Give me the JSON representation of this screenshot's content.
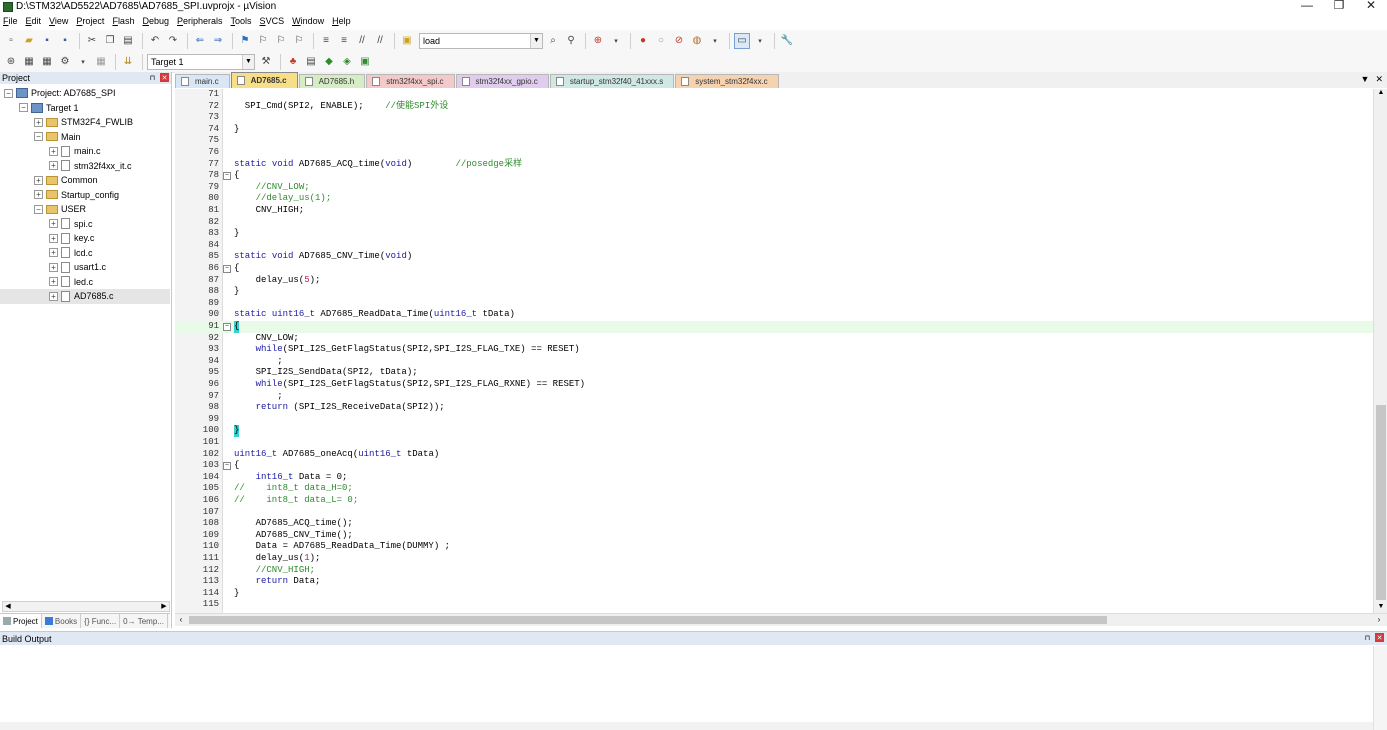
{
  "window": {
    "title": "D:\\STM32\\AD5522\\AD7685\\AD7685_SPI.uvprojx - µVision",
    "controls": [
      "—",
      "❐",
      "✕"
    ]
  },
  "menu": [
    "File",
    "Edit",
    "View",
    "Project",
    "Flash",
    "Debug",
    "Peripherals",
    "Tools",
    "SVCS",
    "Window",
    "Help"
  ],
  "toolbar": {
    "find_combo_value": "load",
    "target_combo_value": "Target 1"
  },
  "project_panel": {
    "title": "Project",
    "tree": [
      {
        "label": "Project: AD7685_SPI",
        "indent": 0,
        "kind": "project",
        "exp": "−"
      },
      {
        "label": "Target 1",
        "indent": 1,
        "kind": "target",
        "exp": "−"
      },
      {
        "label": "STM32F4_FWLIB",
        "indent": 2,
        "kind": "folder",
        "exp": "+"
      },
      {
        "label": "Main",
        "indent": 2,
        "kind": "folder",
        "exp": "−"
      },
      {
        "label": "main.c",
        "indent": 3,
        "kind": "file",
        "exp": "+"
      },
      {
        "label": "stm32f4xx_it.c",
        "indent": 3,
        "kind": "file",
        "exp": "+"
      },
      {
        "label": "Common",
        "indent": 2,
        "kind": "folder",
        "exp": "+"
      },
      {
        "label": "Startup_config",
        "indent": 2,
        "kind": "folder",
        "exp": "+"
      },
      {
        "label": "USER",
        "indent": 2,
        "kind": "folder",
        "exp": "−"
      },
      {
        "label": "spi.c",
        "indent": 3,
        "kind": "file",
        "exp": "+"
      },
      {
        "label": "key.c",
        "indent": 3,
        "kind": "file",
        "exp": "+"
      },
      {
        "label": "lcd.c",
        "indent": 3,
        "kind": "file",
        "exp": "+"
      },
      {
        "label": "usart1.c",
        "indent": 3,
        "kind": "file",
        "exp": "+"
      },
      {
        "label": "led.c",
        "indent": 3,
        "kind": "file",
        "exp": "+"
      },
      {
        "label": "AD7685.c",
        "indent": 3,
        "kind": "file",
        "exp": "+",
        "selected": true
      }
    ],
    "bottom_tabs": [
      "Project",
      "Books",
      "{} Func...",
      "0→ Temp..."
    ]
  },
  "editor_tabs": [
    {
      "label": "main.c",
      "color": "#d8e6f5",
      "active": false
    },
    {
      "label": "AD7685.c",
      "color": "#f7df8a",
      "active": true
    },
    {
      "label": "AD7685.h",
      "color": "#d5ecc4",
      "active": false
    },
    {
      "label": "stm32f4xx_spi.c",
      "color": "#f3c9c9",
      "active": false
    },
    {
      "label": "stm32f4xx_gpio.c",
      "color": "#e0cdee",
      "active": false
    },
    {
      "label": "startup_stm32f40_41xxx.s",
      "color": "#cfe8e3",
      "active": false
    },
    {
      "label": "system_stm32f4xx.c",
      "color": "#f6d3b0",
      "active": false
    }
  ],
  "code_lines": [
    {
      "n": "71",
      "t": ""
    },
    {
      "n": "72",
      "t": "  SPI_Cmd(SPI2, ENABLE);    //使能SPI外设"
    },
    {
      "n": "73",
      "t": ""
    },
    {
      "n": "74",
      "t": "}"
    },
    {
      "n": "75",
      "t": ""
    },
    {
      "n": "76",
      "t": ""
    },
    {
      "n": "77",
      "t": "static void AD7685_ACQ_time(void)        //posedge采样"
    },
    {
      "n": "78",
      "t": "{",
      "fold": "−"
    },
    {
      "n": "79",
      "t": "    //CNV_LOW;"
    },
    {
      "n": "80",
      "t": "    //delay_us(1);"
    },
    {
      "n": "81",
      "t": "    CNV_HIGH;"
    },
    {
      "n": "82",
      "t": ""
    },
    {
      "n": "83",
      "t": "}"
    },
    {
      "n": "84",
      "t": ""
    },
    {
      "n": "85",
      "t": "static void AD7685_CNV_Time(void)"
    },
    {
      "n": "86",
      "t": "{",
      "fold": "−"
    },
    {
      "n": "87",
      "t": "    delay_us(5);"
    },
    {
      "n": "88",
      "t": "}"
    },
    {
      "n": "89",
      "t": ""
    },
    {
      "n": "90",
      "t": "static uint16_t AD7685_ReadData_Time(uint16_t tData)"
    },
    {
      "n": "91",
      "t": "{",
      "fold": "−",
      "hl": true,
      "brk": true
    },
    {
      "n": "92",
      "t": "    CNV_LOW;"
    },
    {
      "n": "93",
      "t": "    while(SPI_I2S_GetFlagStatus(SPI2,SPI_I2S_FLAG_TXE) == RESET)"
    },
    {
      "n": "94",
      "t": "        ;"
    },
    {
      "n": "95",
      "t": "    SPI_I2S_SendData(SPI2, tData);"
    },
    {
      "n": "96",
      "t": "    while(SPI_I2S_GetFlagStatus(SPI2,SPI_I2S_FLAG_RXNE) == RESET)"
    },
    {
      "n": "97",
      "t": "        ;"
    },
    {
      "n": "98",
      "t": "    return (SPI_I2S_ReceiveData(SPI2));"
    },
    {
      "n": "99",
      "t": ""
    },
    {
      "n": "100",
      "t": "}",
      "brk": true
    },
    {
      "n": "101",
      "t": ""
    },
    {
      "n": "102",
      "t": "uint16_t AD7685_oneAcq(uint16_t tData)"
    },
    {
      "n": "103",
      "t": "{",
      "fold": "−"
    },
    {
      "n": "104",
      "t": "    int16_t Data = 0;"
    },
    {
      "n": "105",
      "t": "//    int8_t data_H=0;"
    },
    {
      "n": "106",
      "t": "//    int8_t data_L= 0;"
    },
    {
      "n": "107",
      "t": ""
    },
    {
      "n": "108",
      "t": "    AD7685_ACQ_time();"
    },
    {
      "n": "109",
      "t": "    AD7685_CNV_Time();"
    },
    {
      "n": "110",
      "t": "    Data = AD7685_ReadData_Time(DUMMY) ;"
    },
    {
      "n": "111",
      "t": "    delay_us(1);"
    },
    {
      "n": "112",
      "t": "    //CNV_HIGH;"
    },
    {
      "n": "113",
      "t": "    return Data;"
    },
    {
      "n": "114",
      "t": "}"
    },
    {
      "n": "115",
      "t": ""
    }
  ],
  "build_output": {
    "title": "Build Output"
  }
}
